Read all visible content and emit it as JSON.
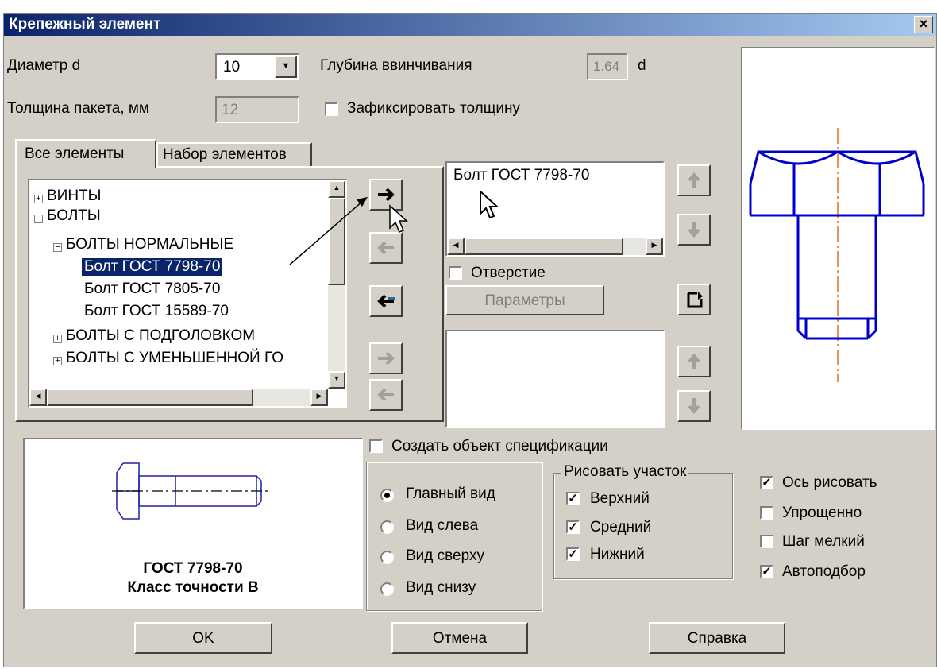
{
  "window": {
    "title": "Крепежный элемент",
    "close": "×"
  },
  "diameter": {
    "label": "Диаметр d",
    "value": "10"
  },
  "depth": {
    "label": "Глубина ввинчивания",
    "value": "1.64",
    "unit": "d"
  },
  "thickness": {
    "label": "Толщина пакета, мм",
    "value": "12"
  },
  "fix_thickness": {
    "label": "Зафиксировать толщину",
    "checked": false
  },
  "tabs": [
    "Все элементы",
    "Набор элементов"
  ],
  "tree": [
    {
      "label": "ВИНТЫ",
      "level": 0,
      "toggle": "+"
    },
    {
      "label": "БОЛТЫ",
      "level": 0,
      "toggle": "−"
    },
    {
      "label": "БОЛТЫ НОРМАЛЬНЫЕ",
      "level": 1,
      "toggle": "−"
    },
    {
      "label": "Болт ГОСТ 7798-70",
      "level": 2,
      "selected": true
    },
    {
      "label": "Болт ГОСТ 7805-70",
      "level": 2
    },
    {
      "label": "Болт ГОСТ 15589-70",
      "level": 2
    },
    {
      "label": "БОЛТЫ С ПОДГОЛОВКОМ",
      "level": 1,
      "toggle": "+"
    },
    {
      "label": "БОЛТЫ С УМЕНЬШЕННОЙ ГО",
      "level": 1,
      "toggle": "+"
    }
  ],
  "selected_list": [
    "Болт ГОСТ 7798-70"
  ],
  "hole": {
    "label": "Отверстие",
    "checked": false
  },
  "params_button": "Параметры",
  "preview": {
    "gost": "ГОСТ 7798-70",
    "class": "Класс точности В"
  },
  "spec": {
    "label": "Создать объект спецификации",
    "checked": false
  },
  "views": [
    {
      "label": "Главный вид",
      "selected": true
    },
    {
      "label": "Вид слева",
      "selected": false
    },
    {
      "label": "Вид сверху",
      "selected": false
    },
    {
      "label": "Вид снизу",
      "selected": false
    }
  ],
  "draw_section": {
    "title": "Рисовать участок",
    "items": [
      {
        "label": "Верхний",
        "checked": true
      },
      {
        "label": "Средний",
        "checked": true
      },
      {
        "label": "Нижний",
        "checked": true
      }
    ]
  },
  "options": [
    {
      "label": "Ось рисовать",
      "checked": true
    },
    {
      "label": "Упрощенно",
      "checked": false
    },
    {
      "label": "Шаг мелкий",
      "checked": false
    },
    {
      "label": "Автоподбор",
      "checked": true
    }
  ],
  "buttons": {
    "ok": "OK",
    "cancel": "Отмена",
    "help": "Справка"
  },
  "colors": {
    "title_from": "#0a246a",
    "title_to": "#a6caf0",
    "drawing": "#0000cc",
    "axis": "#e07020",
    "selection": "#0a246a"
  }
}
